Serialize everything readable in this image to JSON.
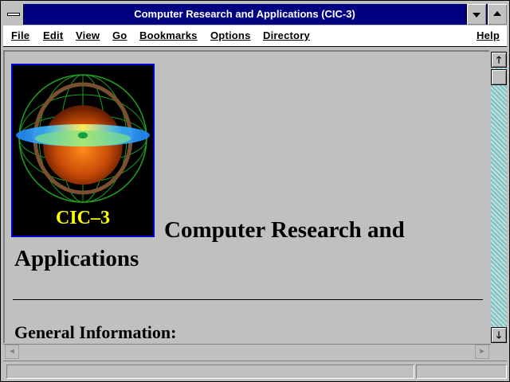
{
  "window": {
    "title": "Computer Research and Applications (CIC-3)"
  },
  "menubar": {
    "items": [
      {
        "label": "File"
      },
      {
        "label": "Edit"
      },
      {
        "label": "View"
      },
      {
        "label": "Go"
      },
      {
        "label": "Bookmarks"
      },
      {
        "label": "Options"
      },
      {
        "label": "Directory"
      },
      {
        "label": "Help"
      }
    ]
  },
  "page": {
    "logo_text": "CIC–3",
    "heading": "Computer Research and Applications",
    "subheading": "General Information:"
  },
  "icons": {
    "system_menu": "system-menu-icon",
    "minimize": "minimize-icon",
    "maximize": "maximize-icon",
    "scroll_up": "arrow-up-icon",
    "scroll_down": "arrow-down-icon",
    "scroll_left": "arrow-left-icon",
    "scroll_right": "arrow-right-icon"
  },
  "colors": {
    "titlebar": "#000080",
    "logo_text": "#ffff00",
    "scroll_track": "#008080"
  }
}
